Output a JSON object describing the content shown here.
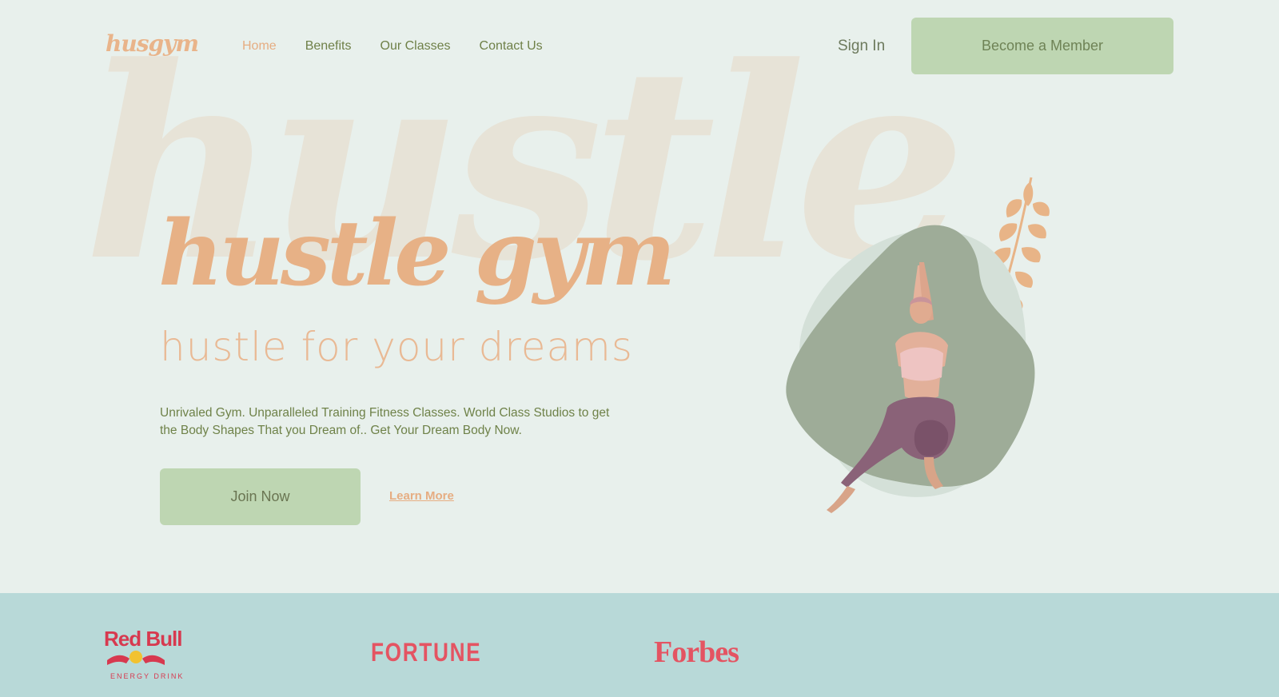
{
  "nav": {
    "logo": "husgym",
    "links": [
      {
        "label": "Home",
        "active": true
      },
      {
        "label": "Benefits",
        "active": false
      },
      {
        "label": "Our Classes",
        "active": false
      },
      {
        "label": "Contact Us",
        "active": false
      }
    ],
    "sign_in": "Sign In",
    "cta": "Become a Member"
  },
  "hero": {
    "background_word": "hustle",
    "title": "hustle gym",
    "subtitle": "hustle for your dreams",
    "description": "Unrivaled Gym. Unparalleled Training Fitness Classes. World Class Studios to get the Body Shapes That you Dream of.. Get Your Dream Body Now.",
    "join_button": "Join Now",
    "learn_more": "Learn More"
  },
  "brands": {
    "redbull": {
      "name": "Red Bull",
      "tagline": "ENERGY DRINK"
    },
    "fortune": "FORTUNE",
    "forbes": "Forbes"
  },
  "colors": {
    "background": "#e8f0ec",
    "accent_peach": "#e7b186",
    "accent_green": "#bed6b2",
    "text_green": "#6f8249",
    "brand_bar": "#b8d9d8",
    "brand_red": "#e45462"
  }
}
